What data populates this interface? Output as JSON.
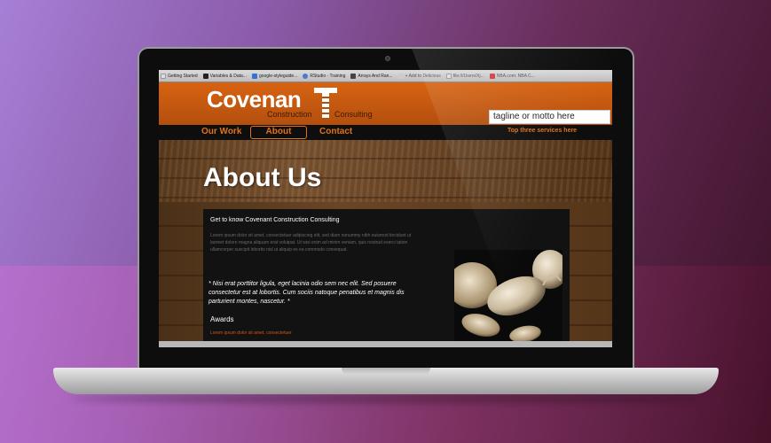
{
  "bookmarks": [
    {
      "label": "Getting Started",
      "icon": "page-icon",
      "color": "#dddddd"
    },
    {
      "label": "Variables & Data...",
      "icon": "c-icon",
      "color": "#222222"
    },
    {
      "label": "google-styleguide...",
      "icon": "google-icon",
      "color": "#3a6fd6"
    },
    {
      "label": "RStudio - Training",
      "icon": "r-icon",
      "color": "#4a7ac8"
    },
    {
      "label": "Arrays And Ran...",
      "icon": "array-icon",
      "color": "#444444"
    },
    {
      "label": "+ Add to Delicious",
      "icon": "plus-icon",
      "color": "#cccccc"
    },
    {
      "label": "file:///Users/Xj...",
      "icon": "file-icon",
      "color": "#dddddd"
    },
    {
      "label": "NBA.com: NBA C...",
      "icon": "nba-icon",
      "color": "#d04040"
    }
  ],
  "header": {
    "logo_main": "Covenan",
    "logo_sub1": "Construction",
    "logo_sub2": "Consulting",
    "tagline": "tagline or motto here"
  },
  "nav": {
    "our_work": "Our Work",
    "about": "About",
    "contact": "Contact",
    "services": "Top three services here"
  },
  "hero": {
    "title": "About Us"
  },
  "card": {
    "heading": "Get to know Covenant Construction Consulting",
    "lorem": "Lorem ipsum dolor sit amet, consectetuer adipiscing elit, sed diam nonummy nibh euismod tincidunt ut laoreet dolore magna aliquam erat volutpat. Ut wisi enim ad minim veniam, quis nostrud exerci tation ullamcorper suscipit lobortis nisl ut aliquip ex ea commodo consequat.",
    "quote": "* Nisi erat porttitor ligula, eget lacinia odio sem nec elit. Sed posuere consectetur est at lobortis. Cum sociis natoque penatibus et magnis dis parturient montes, nascetur. *",
    "awards": "Awards",
    "awards_link": "Lorem ipsum dolor sit amet, consectetuer"
  },
  "colors": {
    "brand_orange": "#d76312",
    "nav_accent": "#e0731a"
  }
}
